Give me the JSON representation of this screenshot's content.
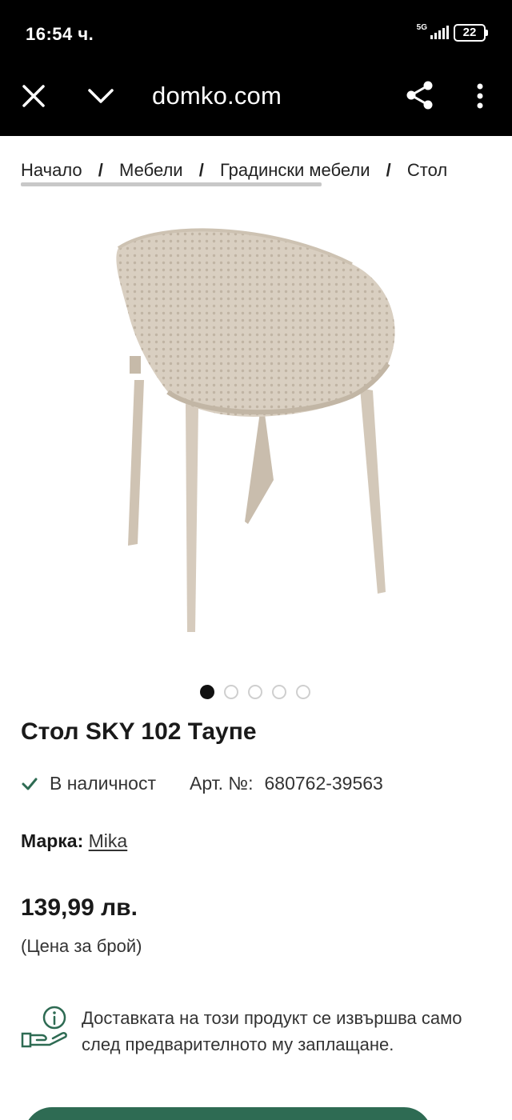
{
  "status_bar": {
    "time": "16:54 ч.",
    "network": "5G",
    "battery": "22"
  },
  "toolbar": {
    "url": "domko.com",
    "icons": [
      "close-icon",
      "chevron-down-icon",
      "share-icon",
      "more-vert-icon"
    ]
  },
  "breadcrumb": {
    "items": [
      "Начало",
      "Мебели",
      "Градински мебели",
      "Стол"
    ],
    "separator": "/"
  },
  "gallery": {
    "image_count": 5,
    "active_index": 0
  },
  "product": {
    "title": "Стол SKY 102 Таупе",
    "stock": "В наличност",
    "sku_label": "Арт. №:",
    "sku": "680762-39563",
    "brand_label": "Марка:",
    "brand": "Mika",
    "price": "139,99 лв.",
    "price_note": "(Цена за брой)"
  },
  "notice": {
    "text": "Доставката на този продукт се извършва само след предварителното му заплащане."
  },
  "colors": {
    "accent": "#2e6b53",
    "stock_check": "#2e6b53",
    "chair": "#d6cbbd"
  }
}
